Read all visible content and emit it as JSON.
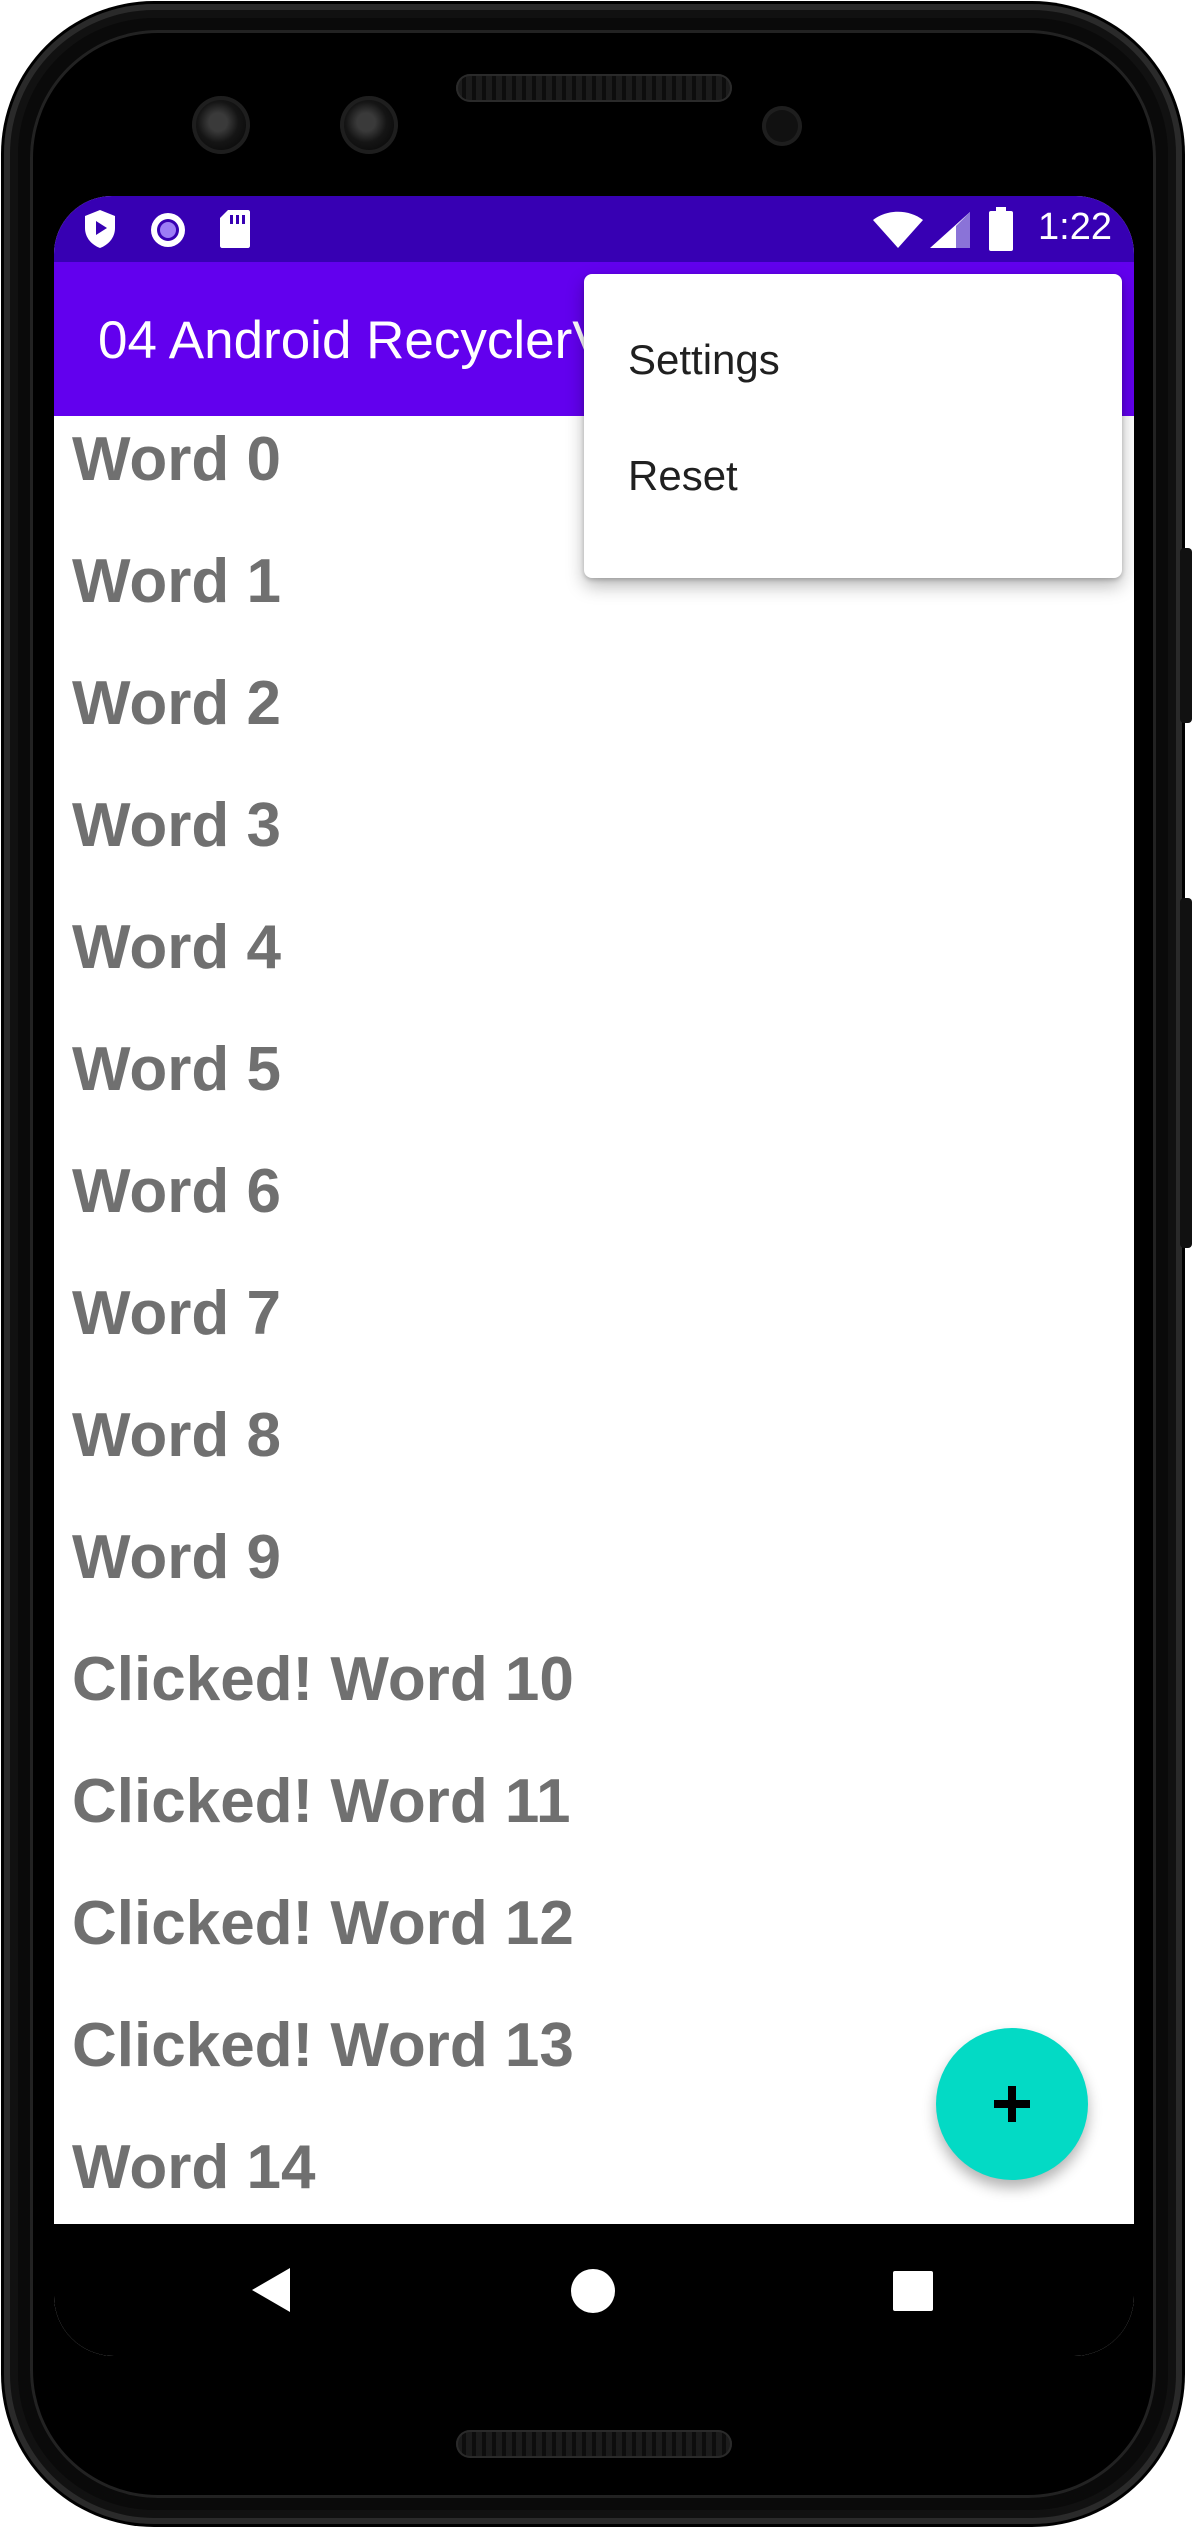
{
  "status_bar": {
    "time": "1:22",
    "left_icons": [
      "shield-icon",
      "circle-dot-icon",
      "sd-card-icon"
    ],
    "right_icons": [
      "wifi-icon",
      "signal-icon",
      "battery-icon"
    ]
  },
  "app_bar": {
    "title": "04 Android RecyclerView"
  },
  "overflow_menu": {
    "items": [
      {
        "label": "Settings"
      },
      {
        "label": "Reset"
      }
    ]
  },
  "word_list": {
    "items": [
      {
        "text": "Word 0"
      },
      {
        "text": "Word 1"
      },
      {
        "text": "Word 2"
      },
      {
        "text": "Word 3"
      },
      {
        "text": "Word 4"
      },
      {
        "text": "Word 5"
      },
      {
        "text": "Word 6"
      },
      {
        "text": "Word 7"
      },
      {
        "text": "Word 8"
      },
      {
        "text": "Word 9"
      },
      {
        "text": "Clicked! Word 10"
      },
      {
        "text": "Clicked! Word 11"
      },
      {
        "text": "Clicked! Word 12"
      },
      {
        "text": "Clicked! Word 13"
      },
      {
        "text": "Word 14"
      }
    ]
  },
  "fab": {
    "icon": "plus-icon"
  },
  "nav_bar": {
    "icons": [
      "back-icon",
      "home-icon",
      "recents-icon"
    ]
  },
  "colors": {
    "status_bar": "#3700b3",
    "app_bar": "#6200ee",
    "fab": "#03dac5",
    "list_text": "#707070"
  }
}
